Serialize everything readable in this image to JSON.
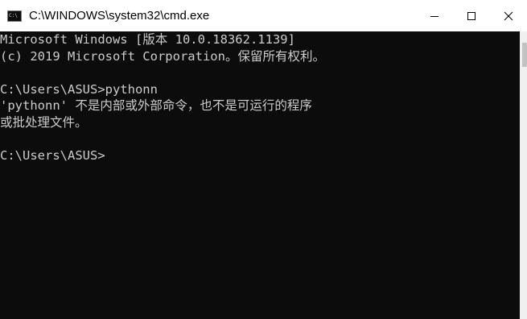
{
  "window": {
    "title": "C:\\WINDOWS\\system32\\cmd.exe",
    "icon_label": "C:\\"
  },
  "console": {
    "lines": [
      "Microsoft Windows [版本 10.0.18362.1139]",
      "(c) 2019 Microsoft Corporation。保留所有权利。",
      "",
      "C:\\Users\\ASUS>pythonn",
      "'pythonn' 不是内部或外部命令，也不是可运行的程序",
      "或批处理文件。",
      "",
      "C:\\Users\\ASUS>"
    ]
  },
  "colors": {
    "console_bg": "#0c0c0c",
    "console_text": "#cccccc",
    "titlebar_bg": "#ffffff"
  }
}
